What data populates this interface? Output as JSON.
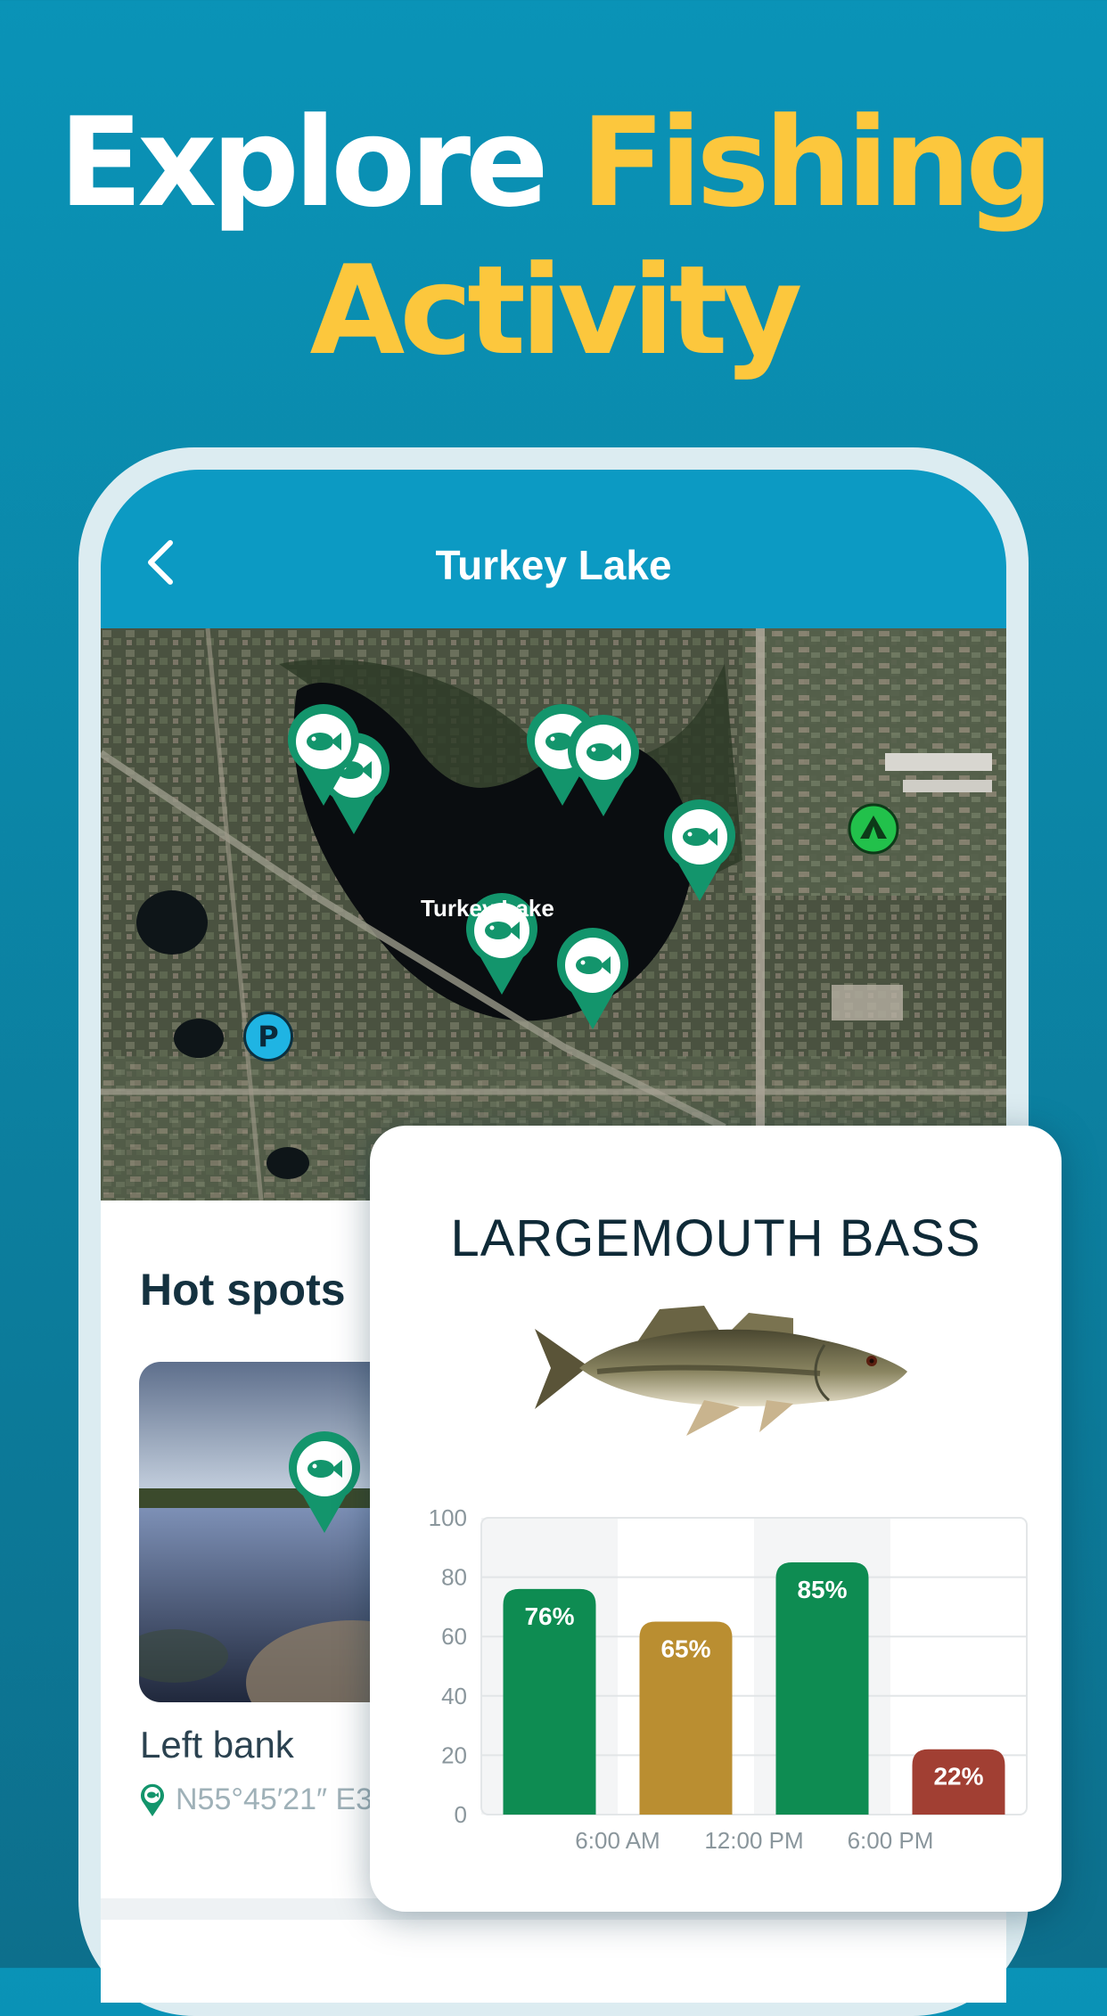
{
  "headline": {
    "word1": "Explore",
    "word2": "Fishing",
    "word3": "Activity",
    "white_color": "#ffffff",
    "accent_color": "#fcc73d"
  },
  "app": {
    "title": "Turkey Lake",
    "back_icon": "chevron-left-icon",
    "header_color": "#0c9ac3"
  },
  "map": {
    "lake_label": "Turkey Lake",
    "pin_icon": "fish-pin-icon",
    "pin_color": "#13956c",
    "parking_label": "P",
    "camping_icon": "tent-icon"
  },
  "hot_spots": {
    "title": "Hot spots",
    "items": [
      {
        "name": "Left bank",
        "coords": "N55°45′21″ E3"
      }
    ]
  },
  "fish_card": {
    "title": "LARGEMOUTH BASS"
  },
  "chart_data": {
    "type": "bar",
    "categories": [
      "",
      "",
      "",
      ""
    ],
    "x_tick_labels": [
      "6:00 AM",
      "12:00 PM",
      "6:00 PM"
    ],
    "values": [
      76,
      65,
      85,
      22
    ],
    "data_labels": [
      "76%",
      "65%",
      "85%",
      "22%"
    ],
    "colors": [
      "#0fa05d",
      "#d4a238",
      "#0fa05d",
      "#b8473a"
    ],
    "ylim": [
      0,
      100
    ],
    "y_ticks": [
      "0",
      "20",
      "40",
      "60",
      "80",
      "100"
    ],
    "grid": true,
    "title": "",
    "xlabel": "",
    "ylabel": ""
  }
}
